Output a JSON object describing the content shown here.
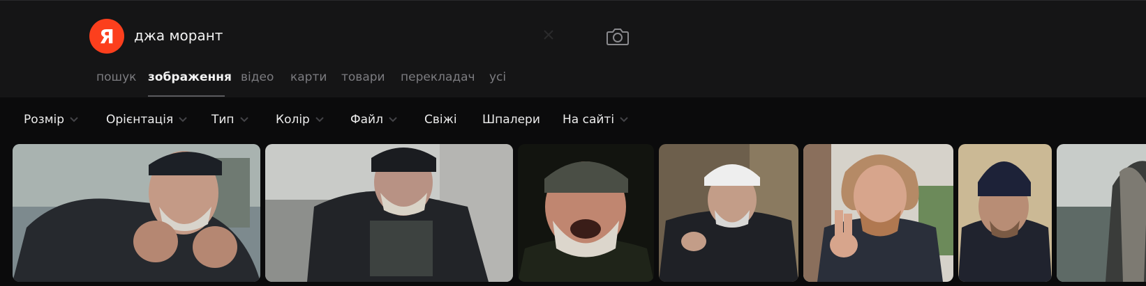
{
  "brand": {
    "logo_letter": "Я",
    "color": "#fc3f1d"
  },
  "search": {
    "query": "джа морант",
    "clear_icon": "close-icon",
    "camera_icon": "camera-icon"
  },
  "tabs": [
    {
      "label": "пошук",
      "active": false
    },
    {
      "label": "зображення",
      "active": true
    },
    {
      "label": "відео",
      "active": false
    },
    {
      "label": "карти",
      "active": false
    },
    {
      "label": "товари",
      "active": false
    },
    {
      "label": "перекладач",
      "active": false
    },
    {
      "label": "усі",
      "active": false
    }
  ],
  "filters": [
    {
      "label": "Розмір",
      "has_dropdown": true
    },
    {
      "label": "Орієнтація",
      "has_dropdown": true
    },
    {
      "label": "Тип",
      "has_dropdown": true
    },
    {
      "label": "Колір",
      "has_dropdown": true
    },
    {
      "label": "Файл",
      "has_dropdown": true
    },
    {
      "label": "Свіжі",
      "has_dropdown": false
    },
    {
      "label": "Шпалери",
      "has_dropdown": false
    },
    {
      "label": "На сайті",
      "has_dropdown": true
    }
  ],
  "results": [
    {
      "name": "result-image-1",
      "subject": "man with beard and knit hat, raising fists"
    },
    {
      "name": "result-image-2",
      "subject": "bearded man in black hat outdoors"
    },
    {
      "name": "result-image-3",
      "subject": "laughing man with grey beard and cap"
    },
    {
      "name": "result-image-4",
      "subject": "man in white captain hat sitting"
    },
    {
      "name": "result-image-5",
      "subject": "man with wild hair making peace sign"
    },
    {
      "name": "result-image-6",
      "subject": "man in dark blue knit hat"
    },
    {
      "name": "result-image-7",
      "subject": "man with long hair, partially visible"
    }
  ]
}
